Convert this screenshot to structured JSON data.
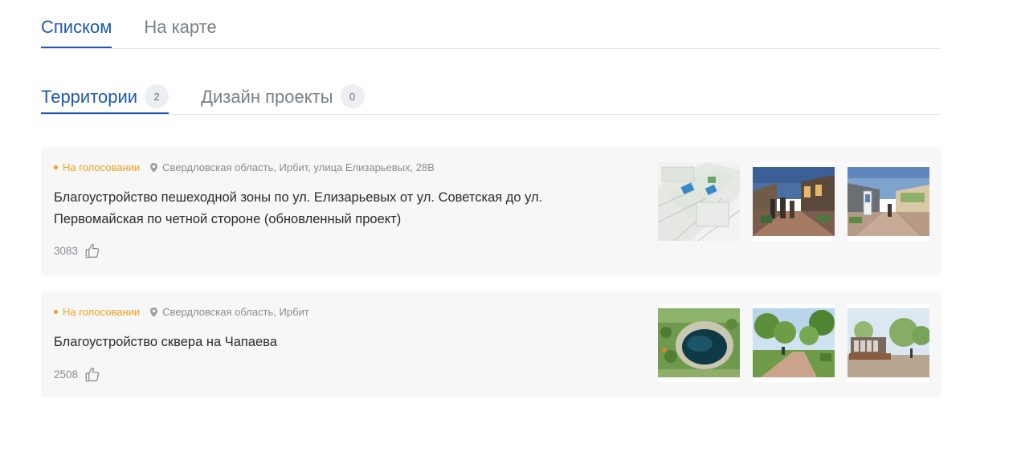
{
  "view_tabs": [
    {
      "label": "Списком",
      "active": true
    },
    {
      "label": "На карте",
      "active": false
    }
  ],
  "category_tabs": [
    {
      "label": "Территории",
      "count": "2",
      "active": true
    },
    {
      "label": "Дизайн проекты",
      "count": "0",
      "active": false
    }
  ],
  "cards": [
    {
      "status": "На голосовании",
      "location": "Свердловская область, Ирбит, улица Елизарьевых, 28В",
      "title": "Благоустройство пешеходной зоны по ул. Елизарьевых от ул. Советская до ул. Первомайская по четной стороне (обновленный проект)",
      "likes": "3083",
      "thumbnails": [
        "site-plan-drawing",
        "evening-street-people",
        "street-with-info-stand"
      ]
    },
    {
      "status": "На голосовании",
      "location": "Свердловская область, Ирбит",
      "title": "Благоустройство сквера на Чапаева",
      "likes": "2508",
      "thumbnails": [
        "aerial-pond-park",
        "park-walkway-trees",
        "park-sign-letters"
      ]
    }
  ],
  "colors": {
    "accent": "#1f56b5",
    "status": "#f0a01a",
    "muted": "#878c92",
    "card_bg": "#f7f7f8"
  }
}
